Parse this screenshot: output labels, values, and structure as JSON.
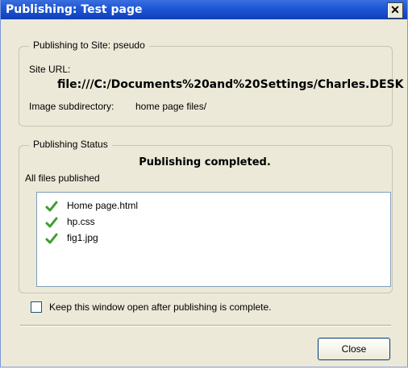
{
  "window": {
    "title": "Publishing: Test page",
    "close_glyph": "✕"
  },
  "site_group": {
    "legend": "Publishing to Site: pseudo",
    "site_url_label": "Site URL:",
    "site_url": "file:///C:/Documents%20and%20Settings/Charles.DESK",
    "image_subdir_label": "Image subdirectory:",
    "image_subdir_value": "home page files/"
  },
  "status_group": {
    "legend": "Publishing Status",
    "message": "Publishing completed.",
    "summary": "All files published",
    "files": [
      {
        "name": "Home page.html",
        "icon": "checkmark-icon"
      },
      {
        "name": "hp.css",
        "icon": "checkmark-icon"
      },
      {
        "name": "fig1.jpg",
        "icon": "checkmark-icon"
      }
    ]
  },
  "keep_open": {
    "label": "Keep this window open after publishing is complete.",
    "checked": false
  },
  "buttons": {
    "close_label": "Close"
  },
  "colors": {
    "titlebar": "#1e56d4",
    "checkmark": "#3f9d2f",
    "dialog_bg": "#ece9d8"
  }
}
